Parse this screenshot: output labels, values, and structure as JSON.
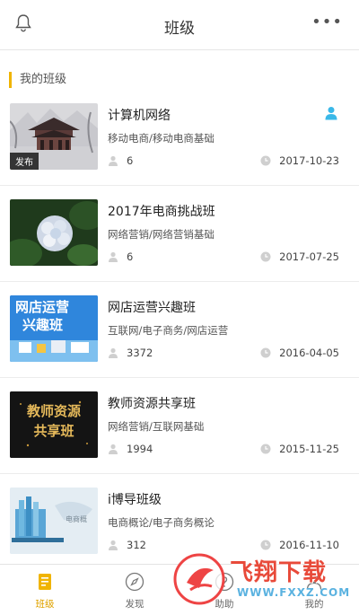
{
  "header": {
    "title": "班级",
    "bell_icon": "bell-icon",
    "more_icon": "more-dots-icon",
    "more_text": "•••"
  },
  "section": {
    "title": "我的班级"
  },
  "classes": [
    {
      "name": "计算机网络",
      "category": "移动电商/移动电商基础",
      "members": "6",
      "date": "2017-10-23",
      "tag": "发布",
      "has_role_icon": true
    },
    {
      "name": "2017年电商挑战班",
      "category": "网络营销/网络营销基础",
      "members": "6",
      "date": "2017-07-25"
    },
    {
      "name": "网店运营兴趣班",
      "category": "互联网/电子商务/网店运营",
      "members": "3372",
      "date": "2016-04-05",
      "thumb_text": [
        "网店运营",
        "兴趣班"
      ]
    },
    {
      "name": "教师资源共享班",
      "category": "网络营销/互联网基础",
      "members": "1994",
      "date": "2015-11-25",
      "thumb_text": [
        "教师资源",
        "共享班"
      ]
    },
    {
      "name": "i博导班级",
      "category": "电商概论/电子商务概论",
      "members": "312",
      "date": "2016-11-10",
      "thumb_text": [
        "电商概"
      ]
    }
  ],
  "tabs": [
    {
      "label": "班级",
      "icon": "class-book-icon",
      "active": true
    },
    {
      "label": "发现",
      "icon": "compass-icon"
    },
    {
      "label": "助助",
      "icon": "help-icon"
    },
    {
      "label": "我的",
      "icon": "user-icon"
    }
  ],
  "watermark": {
    "text": "飞翔下载",
    "url": "WWW.FXXZ.COM"
  },
  "colors": {
    "accent": "#f0b400",
    "role_icon": "#3ab8e8",
    "divider": "#ececec"
  }
}
